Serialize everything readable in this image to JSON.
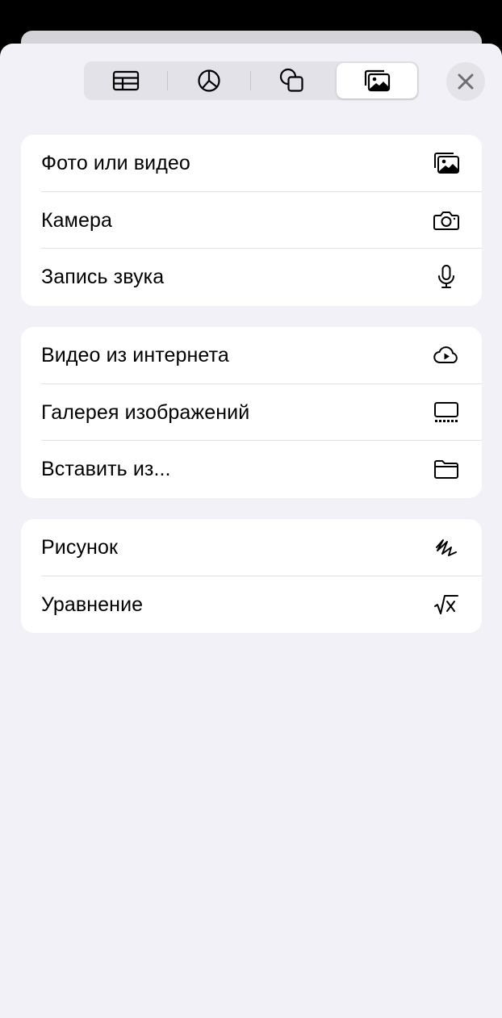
{
  "segmented_control": {
    "segments": [
      {
        "name": "table",
        "icon": "table-icon"
      },
      {
        "name": "chart",
        "icon": "pie-chart-icon"
      },
      {
        "name": "shapes",
        "icon": "shapes-icon"
      },
      {
        "name": "media",
        "icon": "photo-stack-icon",
        "selected": true
      }
    ]
  },
  "close_icon": "xmark-icon",
  "groups": [
    {
      "items": [
        {
          "label": "Фото или видео",
          "icon": "photo-library-icon"
        },
        {
          "label": "Камера",
          "icon": "camera-icon"
        },
        {
          "label": "Запись звука",
          "icon": "microphone-icon"
        }
      ]
    },
    {
      "items": [
        {
          "label": "Видео из интернета",
          "icon": "cloud-play-icon"
        },
        {
          "label": "Галерея изображений",
          "icon": "image-gallery-icon"
        },
        {
          "label": "Вставить из...",
          "icon": "folder-icon"
        }
      ]
    },
    {
      "items": [
        {
          "label": "Рисунок",
          "icon": "scribble-icon"
        },
        {
          "label": "Уравнение",
          "icon": "square-root-icon"
        }
      ]
    }
  ],
  "colors": {
    "sheet_background": "#f2f1f7",
    "row_background": "#ffffff",
    "text": "#000000",
    "separator": "#e0e0e4"
  }
}
